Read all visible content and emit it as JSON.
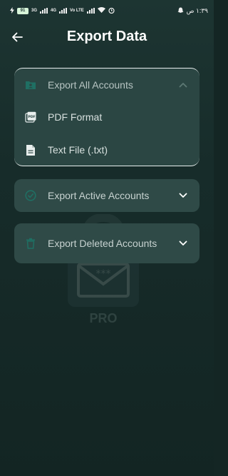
{
  "status_bar": {
    "battery": "91",
    "network_1": "3G",
    "network_2": "4G",
    "network_3": "Vo LTE",
    "time": "١:٣٩ ص"
  },
  "app_bar": {
    "title": "Export Data",
    "back_icon": "arrow-back-icon"
  },
  "background_logo": {
    "text": "PRO",
    "icon": "envelope-password-icon"
  },
  "sections": [
    {
      "label": "Export All Accounts",
      "icon": "account-box-icon",
      "expanded": true,
      "options": [
        {
          "label": "PDF Format",
          "icon": "pdf-icon"
        },
        {
          "label": "Text File (.txt)",
          "icon": "text-file-icon"
        }
      ]
    },
    {
      "label": "Export Active Accounts",
      "icon": "check-circle-icon",
      "expanded": false
    },
    {
      "label": "Export Deleted Accounts",
      "icon": "trash-icon",
      "expanded": false
    }
  ],
  "colors": {
    "background": "#172c2a",
    "card": "#2f4a47",
    "accent_icon": "#1f6f63",
    "text": "#c7d2d0"
  }
}
